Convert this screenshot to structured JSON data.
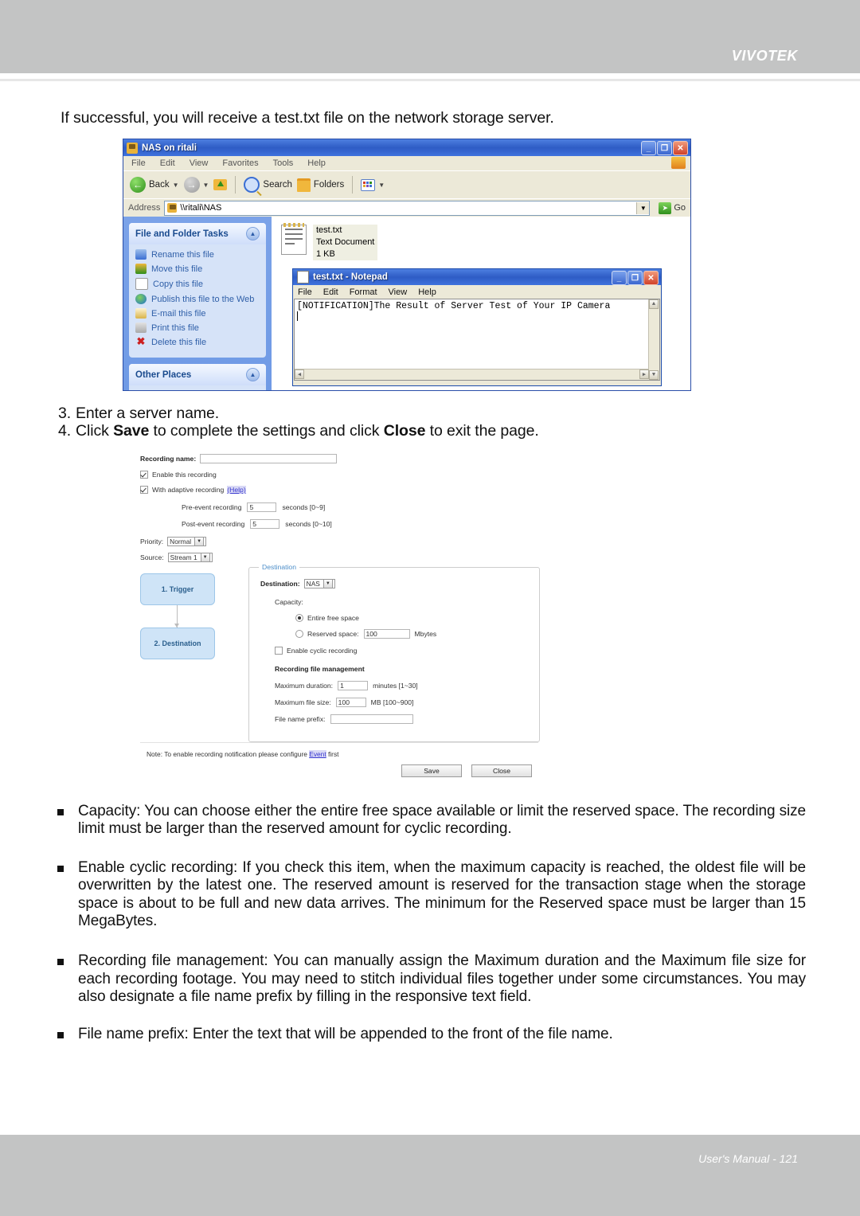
{
  "page": {
    "brand": "VIVOTEK",
    "footer": "User's Manual - 121",
    "intro": "If successful, you will receive a test.txt file on the network storage server.",
    "steps": [
      {
        "num": "3.",
        "pre": "Enter a server name.",
        "bold1": "",
        "mid": "",
        "bold2": "",
        "post": ""
      },
      {
        "num": "4.",
        "pre": "Click ",
        "bold1": "Save",
        "mid": " to complete the settings and click ",
        "bold2": "Close",
        "post": " to exit the page."
      }
    ],
    "bullets": [
      "Capacity: You can choose either the entire free space available or limit the reserved space. The recording size limit must be larger than the reserved amount for cyclic recording.",
      "Enable cyclic recording: If you check this item, when the maximum capacity is reached, the oldest file will be overwritten by the latest one. The reserved amount is reserved for the transaction stage when the storage space is about to be full and new data arrives. The minimum for the Reserved space must be larger than 15 MegaBytes.",
      "Recording file management: You can manually assign the Maximum duration and the Maximum file size for each recording footage. You may need to stitch individual files together under some circumstances. You may also designate a file name prefix by filling in the responsive text field.",
      "File name prefix: Enter the text that will be appended to the front of the file name."
    ]
  },
  "explorer": {
    "title": "NAS on ritali",
    "menus": [
      "File",
      "Edit",
      "View",
      "Favorites",
      "Tools",
      "Help"
    ],
    "toolbar": {
      "back": "Back",
      "search": "Search",
      "folders": "Folders"
    },
    "address_label": "Address",
    "address_value": "\\\\ritali\\NAS",
    "go_label": "Go",
    "panels": [
      {
        "title": "File and Folder Tasks",
        "items": [
          "Rename this file",
          "Move this file",
          "Copy this file",
          "Publish this file to the Web",
          "E-mail this file",
          "Print this file",
          "Delete this file"
        ]
      },
      {
        "title": "Other Places",
        "items": []
      }
    ],
    "file": {
      "name": "test.txt",
      "type": "Text Document",
      "size": "1 KB"
    },
    "window_buttons": {
      "minimize": "_",
      "maximize": "❐",
      "close": "✕"
    }
  },
  "notepad": {
    "title": "test.txt - Notepad",
    "menus": [
      "File",
      "Edit",
      "Format",
      "View",
      "Help"
    ],
    "content": "[NOTIFICATION]The Result of Server Test of Your IP Camera",
    "window_buttons": {
      "minimize": "_",
      "maximize": "❐",
      "close": "✕"
    }
  },
  "recording_form": {
    "recording_name_label": "Recording name:",
    "recording_name_value": "",
    "enable_recording_label": "Enable this recording",
    "enable_recording_checked": true,
    "adaptive_label": "With adaptive recording",
    "adaptive_help": "(Help)",
    "adaptive_checked": true,
    "pre_event_label": "Pre-event recording",
    "pre_event_value": "5",
    "pre_event_unit": "seconds [0~9]",
    "post_event_label": "Post-event recording",
    "post_event_value": "5",
    "post_event_unit": "seconds [0~10]",
    "priority_label": "Priority:",
    "priority_value": "Normal",
    "source_label": "Source:",
    "source_value": "Stream 1",
    "flow": {
      "step1": "1. Trigger",
      "step2": "2. Destination"
    },
    "destination": {
      "legend": "Destination",
      "dest_label": "Destination:",
      "dest_value": "NAS",
      "capacity_label": "Capacity:",
      "entire_free_label": "Entire free space",
      "entire_free_selected": true,
      "reserved_label": "Reserved space:",
      "reserved_value": "100",
      "reserved_unit": "Mbytes",
      "cyclic_label": "Enable cyclic recording",
      "cyclic_checked": false,
      "file_mgmt_title": "Recording file management",
      "max_duration_label": "Maximum duration:",
      "max_duration_value": "1",
      "max_duration_unit": "minutes [1~30]",
      "max_filesize_label": "Maximum file size:",
      "max_filesize_value": "100",
      "max_filesize_unit": "MB [100~900]",
      "prefix_label": "File name prefix:",
      "prefix_value": ""
    },
    "note_pre": "Note: To enable recording notification please configure ",
    "note_link": "Event",
    "note_post": " first",
    "save_label": "Save",
    "close_label": "Close"
  }
}
